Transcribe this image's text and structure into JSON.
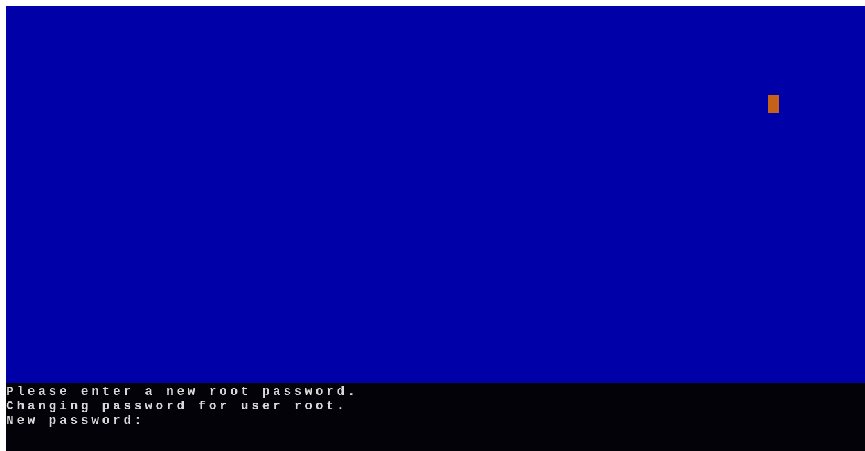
{
  "console_lines": [
    "Please enter a new root password.",
    "Changing password for user root."
  ],
  "prompt": {
    "label": "New password:"
  }
}
